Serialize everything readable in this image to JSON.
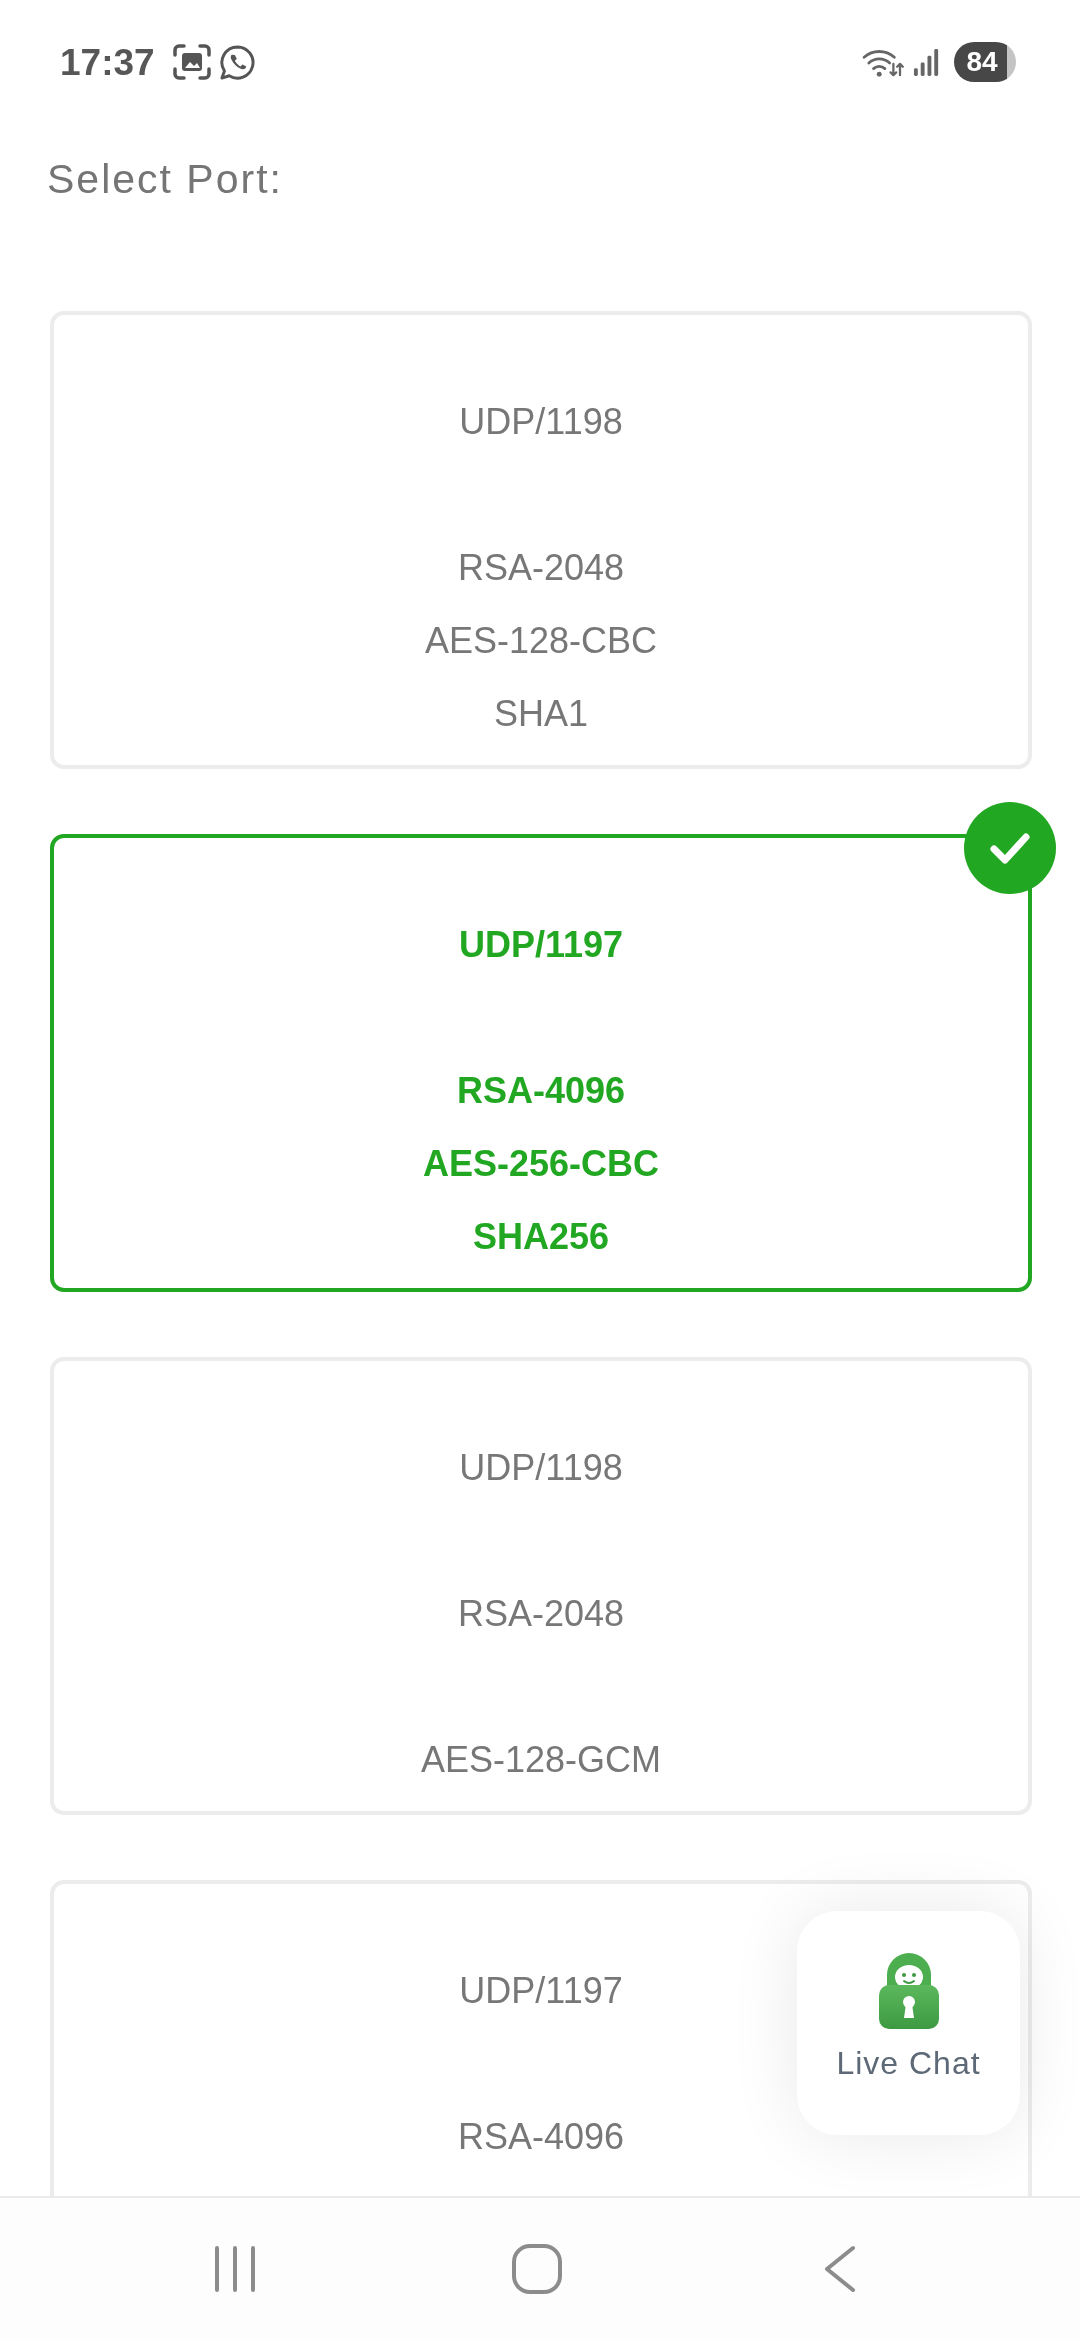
{
  "status_bar": {
    "time": "17:37",
    "battery": "84"
  },
  "title": "Select Port:",
  "ports": [
    {
      "port": "UDP/1198",
      "details": [
        "RSA-2048",
        "AES-128-CBC",
        "SHA1"
      ],
      "selected": false
    },
    {
      "port": "UDP/1197",
      "details": [
        "RSA-4096",
        "AES-256-CBC",
        "SHA256"
      ],
      "selected": true
    },
    {
      "port": "UDP/1198",
      "details": [
        "RSA-2048",
        "AES-128-GCM"
      ],
      "selected": false
    },
    {
      "port": "UDP/1197",
      "details": [
        "RSA-4096"
      ],
      "selected": false
    }
  ],
  "live_chat": {
    "label": "Live Chat"
  }
}
